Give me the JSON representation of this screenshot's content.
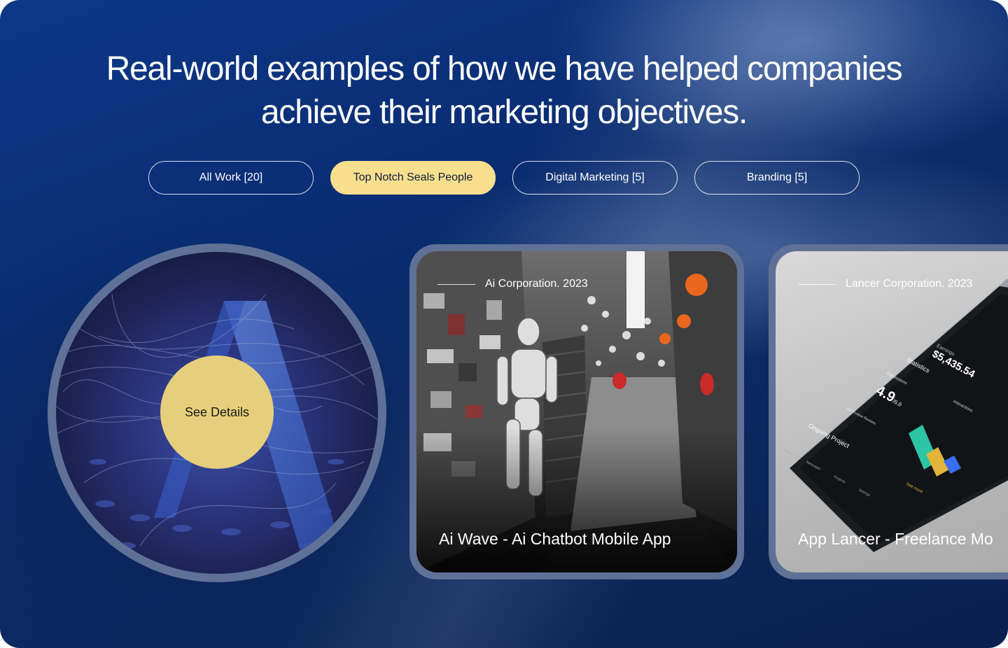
{
  "headline": {
    "line1": "Real-world examples of how we have helped companies",
    "line2": "achieve their marketing objectives."
  },
  "filters": [
    {
      "label": "All Work [20]",
      "active": false
    },
    {
      "label": "Top Notch Seals People",
      "active": true
    },
    {
      "label": "Digital Marketing [5]",
      "active": false
    },
    {
      "label": "Branding [5]",
      "active": false
    }
  ],
  "featured": {
    "cta_label": "See Details"
  },
  "projects": [
    {
      "meta": "Ai Corporation. 2023",
      "title": "Ai Wave - Ai Chatbot Mobile App"
    },
    {
      "meta": "Lancer Corporation. 2023",
      "title": "App Lancer - Freelance Mo"
    }
  ],
  "phone_screen": {
    "earnings_label": "Earnings",
    "earnings_value": "$5,435.54",
    "statistics_label": "Statistics",
    "impressions_label": "Impressions",
    "rating": "4.9",
    "rating_suffix": "/5.0",
    "reviews_text": "+40 Positive Reviews",
    "interactions_label": "Interactions",
    "ongoing_label": "Ongoing Project",
    "see_more": "See more",
    "nav": [
      "Home",
      "Messages",
      "Projects",
      "Settings"
    ]
  },
  "colors": {
    "accent_yellow": "#f8df8e",
    "button_yellow": "#e6cf7c",
    "frame": "#5f7196",
    "background": "#0a2d72"
  }
}
